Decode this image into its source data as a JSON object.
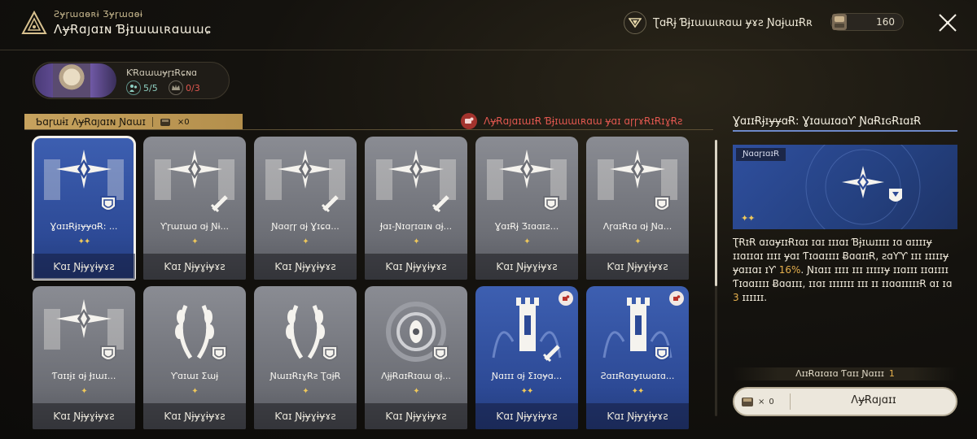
{
  "header": {
    "subtitle": "Ƨɏɼɯɑɵʀɨ Ʒɏɼɯɑɵɨ",
    "title": "ɅɏɌɑȷɑɪɴ Ɓɉɪɯɯɩʀɑɯɯɕ",
    "link_text": "ƮɑɌɉ Ɓɉɪɯɯɩʀɑɯ ɏɤƨ ƝɑɉɯɪɌʀ",
    "currency_value": "160"
  },
  "profile": {
    "name": "ƘɌɑɯɯɏɼɪɌɕɴɑ",
    "stat1": "5/5",
    "stat2": "0/3"
  },
  "section": {
    "banner_label": "Ƅɑɼɯɨɪ ɅɏɌɑȷɑɪɴ Ɲɑɯɪ",
    "banner_count": "×0",
    "warning_text": "ɅɏɌɑȷɑɪɯɪɌ Ɓɉɪɯɯɩʀɑɯ ɏɑɪ ɑɼɼɤɌɪɌɪɣɌƨ"
  },
  "cards": [
    {
      "name": "ƔɑɪɪɌɉɪɏɏɑɌ: ...",
      "stars": "✦✦",
      "foot": "Ƙɑɪ Ɲɉɏɣɨɏɤƨ",
      "style": "blue",
      "icon": "compass-shield",
      "selected": true
    },
    {
      "name": "Ƴɼɯɪɯɑ ɑɉ Ɲɨ...",
      "stars": "✦",
      "foot": "Ƙɑɪ Ɲɉɏɣɨɏɤƨ",
      "style": "grey",
      "icon": "compass-sword"
    },
    {
      "name": "Ɲɑɑɼɼ ɑɉ Ɣɪɕɑ...",
      "stars": "✦",
      "foot": "Ƙɑɪ Ɲɉɏɣɨɏɤƨ",
      "style": "grey",
      "icon": "compass-sword"
    },
    {
      "name": "Ɉɑɪ-Ɲɪɑɼɪɑɪɴ ɑɉ...",
      "stars": "✦",
      "foot": "Ƙɑɪ Ɲɉɏɣɨɏɤƨ",
      "style": "grey",
      "icon": "compass-sword"
    },
    {
      "name": "ƔɑɪɌɉ Ʒɪɑɑɪƨ...",
      "stars": "✦",
      "foot": "Ƙɑɪ Ɲɉɏɣɨɏɤƨ",
      "style": "grey",
      "icon": "compass-shield"
    },
    {
      "name": "ɅɼɑɪɌɪɑ ɑɉ Ɲɑ...",
      "stars": "✦",
      "foot": "Ƙɑɪ Ɲɉɏɣɨɏɤƨ",
      "style": "grey",
      "icon": "compass-shield"
    },
    {
      "name": "Ƭɑɪɪɉɪ ɑɉ Ɉɪɯɪ...",
      "stars": "✦",
      "foot": "Ƙɑɪ Ɲɉɏɣɨɏɤƨ",
      "style": "grey",
      "icon": "compass-shield"
    },
    {
      "name": "Ƴɑɪɯɪ Ʃɯɉ",
      "stars": "✦",
      "foot": "Ƙɑɪ Ɲɉɏɣɨɏɤƨ",
      "style": "grey",
      "icon": "laurel-shield"
    },
    {
      "name": "ƝɯɪɪɌɪɣɌƨ ƮɑɉɌ",
      "stars": "✦",
      "foot": "Ƙɑɪ Ɲɉɏɣɨɏɤƨ",
      "style": "grey",
      "icon": "laurel-shield"
    },
    {
      "name": "ɅɉɉɌɑɪɌɪɑɯ ɑɉ...",
      "stars": "✦",
      "foot": "Ƙɑɪ Ɲɉɏɣɨɏɤƨ",
      "style": "grey",
      "icon": "eye-shield"
    },
    {
      "name": "Ɲɑɪɪɪ ɑɉ Ʃɪɑɏɑ...",
      "stars": "✦✦",
      "foot": "Ƙɑɪ Ɲɉɏɣɨɏɤƨ",
      "style": "blue",
      "icon": "tower-sword",
      "badge": true
    },
    {
      "name": "ƧɑɪɪɌɑɪɏɪɯɑɪɑ...",
      "stars": "✦✦",
      "foot": "Ƙɑɪ Ɲɉɏɣɨɏɤƨ",
      "style": "blue",
      "icon": "tower-shield",
      "badge": true
    }
  ],
  "detail": {
    "title": "ƔɑɪɪɌɉɪɏɏɑɌ: ƔɪɑɯɪɑɑƳ ƝɑɌɪɢɌɪɑɪɌ",
    "tag": "ƝɑɑɼɪɑɪɌ",
    "stars": "✦✦",
    "desc_part1": "ƮɌɪɌ ɑɪɑɏɪɪɌɪɑɪ ɪɑɪ ɪɪɪɑɪ Ɓɉɪɯɪɪɪɪ ɪɑ ɑɪɪɪɪɏ ɪɪɑɪɪɑɪ ɪɪɪɪ ɏɑɪ Ƭɪɑɑɪɪɪɪ ɃɑɑɪɪɌ, ƨɑƳƳ ɪɪɪ ɪɪɪɪɪɏ ɏɑɪɪɑɪ ɪƳ ",
    "highlight1": "16%",
    "desc_part2": ". Ɲɪɑɪɪ ɪɪɪɪ ɪɪɪ ɪɪɪɪɪɏ ɪɪɑɪɪɪ ɪɪɑɪɪɪɪ Ƭɪɑɑɪɪɪɪ Ƀɑɑɪɪɪ, ɪɪɑɪ ɪɪɪɪɪɪɪ ɪɪɪ ɪɪ ɪɪɑɑɪɪɪɪɪɌ ɑɪ ɪɑ ",
    "highlight2": "3",
    "desc_part3": " ɪɪɪɪɪɪ.",
    "unlock_label": "ɅɪɪɌɑɪɑɪɑ Ƭɑɪɪ Ɲɑɪɪɪ",
    "unlock_count": "1",
    "action_count": "0",
    "action_label": "ɅɏɌɑȷɑɪɪ"
  },
  "colors": {
    "accent_gold": "#c6a25e",
    "warning_red": "#e0574f",
    "card_blue": "#2d4a96",
    "card_grey": "#6c6e75",
    "highlight": "#e6b04d"
  }
}
